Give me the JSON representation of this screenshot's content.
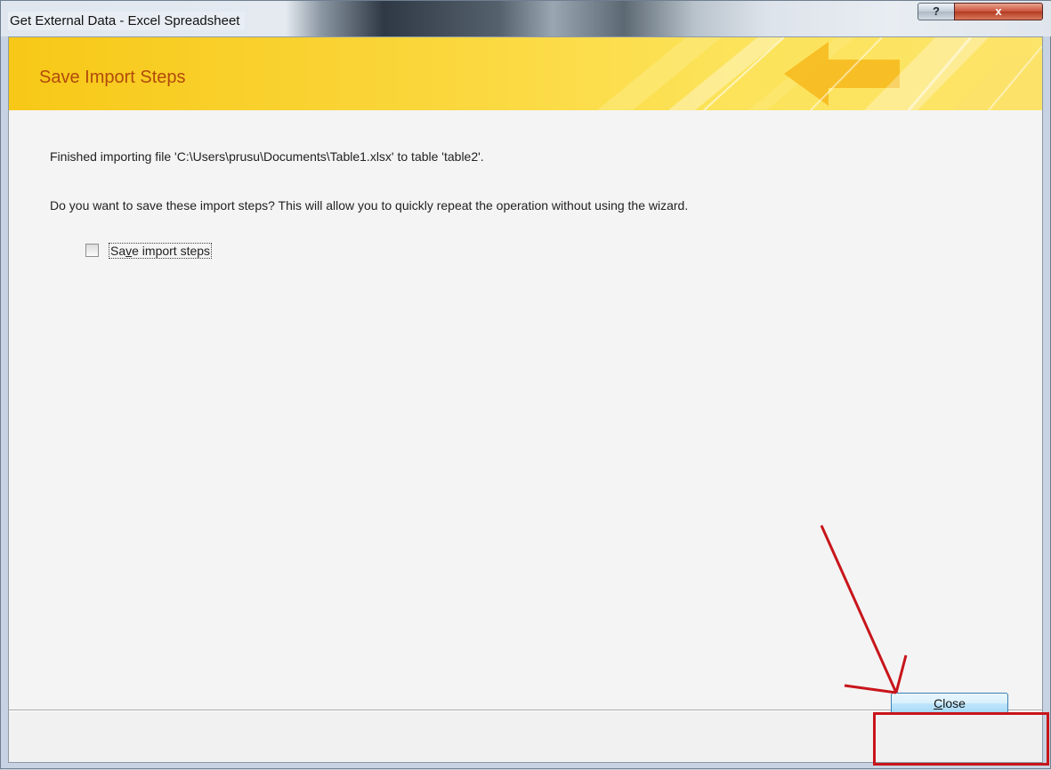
{
  "window": {
    "title": "Get External Data - Excel Spreadsheet",
    "help_label": "?",
    "close_label": "x"
  },
  "banner": {
    "title": "Save Import Steps"
  },
  "content": {
    "finished_message": "Finished importing file 'C:\\Users\\prusu\\Documents\\Table1.xlsx' to table 'table2'.",
    "question": "Do you want to save these import steps? This will allow you to quickly repeat the operation without using the wizard.",
    "save_steps_checkbox": {
      "label_before": "Sa",
      "label_accel": "v",
      "label_after": "e import steps",
      "checked": false
    }
  },
  "footer": {
    "close_button": {
      "accel": "C",
      "rest": "lose"
    }
  },
  "annotation": {
    "color": "#c8151b",
    "icon": "red-arrow-icon"
  },
  "colors": {
    "banner_text": "#b14a0c",
    "banner_bg": "#f7c817"
  }
}
